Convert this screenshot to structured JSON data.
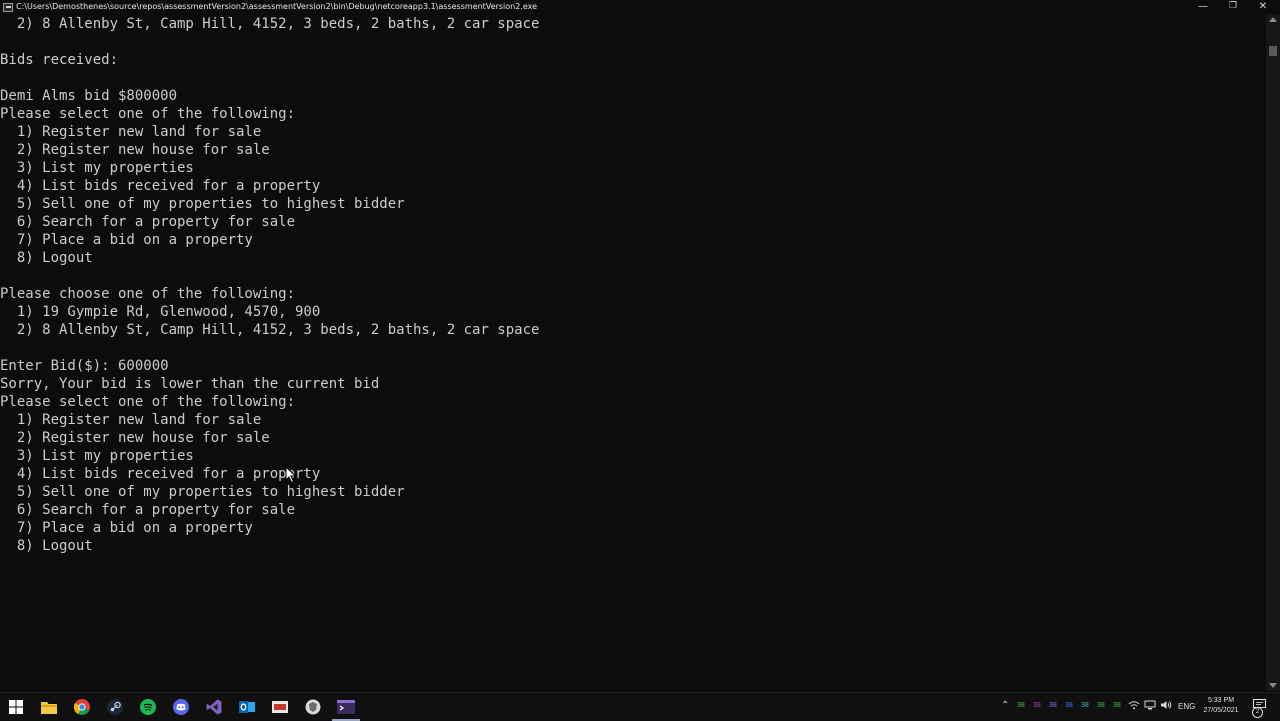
{
  "window": {
    "title": "C:\\Users\\Demosthenes\\source\\repos\\assessmentVersion2\\assessmentVersion2\\bin\\Debug\\netcoreapp3.1\\assessmentVersion2.exe",
    "minimize_glyph": "—",
    "maximize_glyph": "❐",
    "close_glyph": "✕"
  },
  "console": {
    "text_color": "#cccccc",
    "background": "#0c0c0c",
    "lines": [
      "  2) 8 Allenby St, Camp Hill, 4152, 3 beds, 2 baths, 2 car space",
      "",
      "Bids received:",
      "",
      "Demi Alms bid $800000",
      "Please select one of the following:",
      "  1) Register new land for sale",
      "  2) Register new house for sale",
      "  3) List my properties",
      "  4) List bids received for a property",
      "  5) Sell one of my properties to highest bidder",
      "  6) Search for a property for sale",
      "  7) Place a bid on a property",
      "  8) Logout",
      "",
      "Please choose one of the following:",
      "  1) 19 Gympie Rd, Glenwood, 4570, 900",
      "  2) 8 Allenby St, Camp Hill, 4152, 3 beds, 2 baths, 2 car space",
      "",
      "Enter Bid($): 600000",
      "Sorry, Your bid is lower than the current bid",
      "Please select one of the following:",
      "  1) Register new land for sale",
      "  2) Register new house for sale",
      "  3) List my properties",
      "  4) List bids received for a property",
      "  5) Sell one of my properties to highest bidder",
      "  6) Search for a property for sale",
      "  7) Place a bid on a property",
      "  8) Logout"
    ]
  },
  "taskbar": {
    "pinned": [
      "windows-start",
      "file-explorer",
      "chrome",
      "steam",
      "spotify",
      "discord",
      "visual-studio",
      "outlook",
      "mobile-app",
      "security-app",
      "terminal"
    ],
    "tray_numbers": [
      "38",
      "38",
      "38",
      "38",
      "38",
      "38",
      "38"
    ],
    "tray_number_colors": [
      "#3cc24a",
      "#c03cc2",
      "#8a6cff",
      "#3c7cff",
      "#3cc2c2",
      "#3cc24a",
      "#3cc24a"
    ],
    "language": "ENG",
    "time": "5:33 PM",
    "date": "27/05/2021"
  }
}
